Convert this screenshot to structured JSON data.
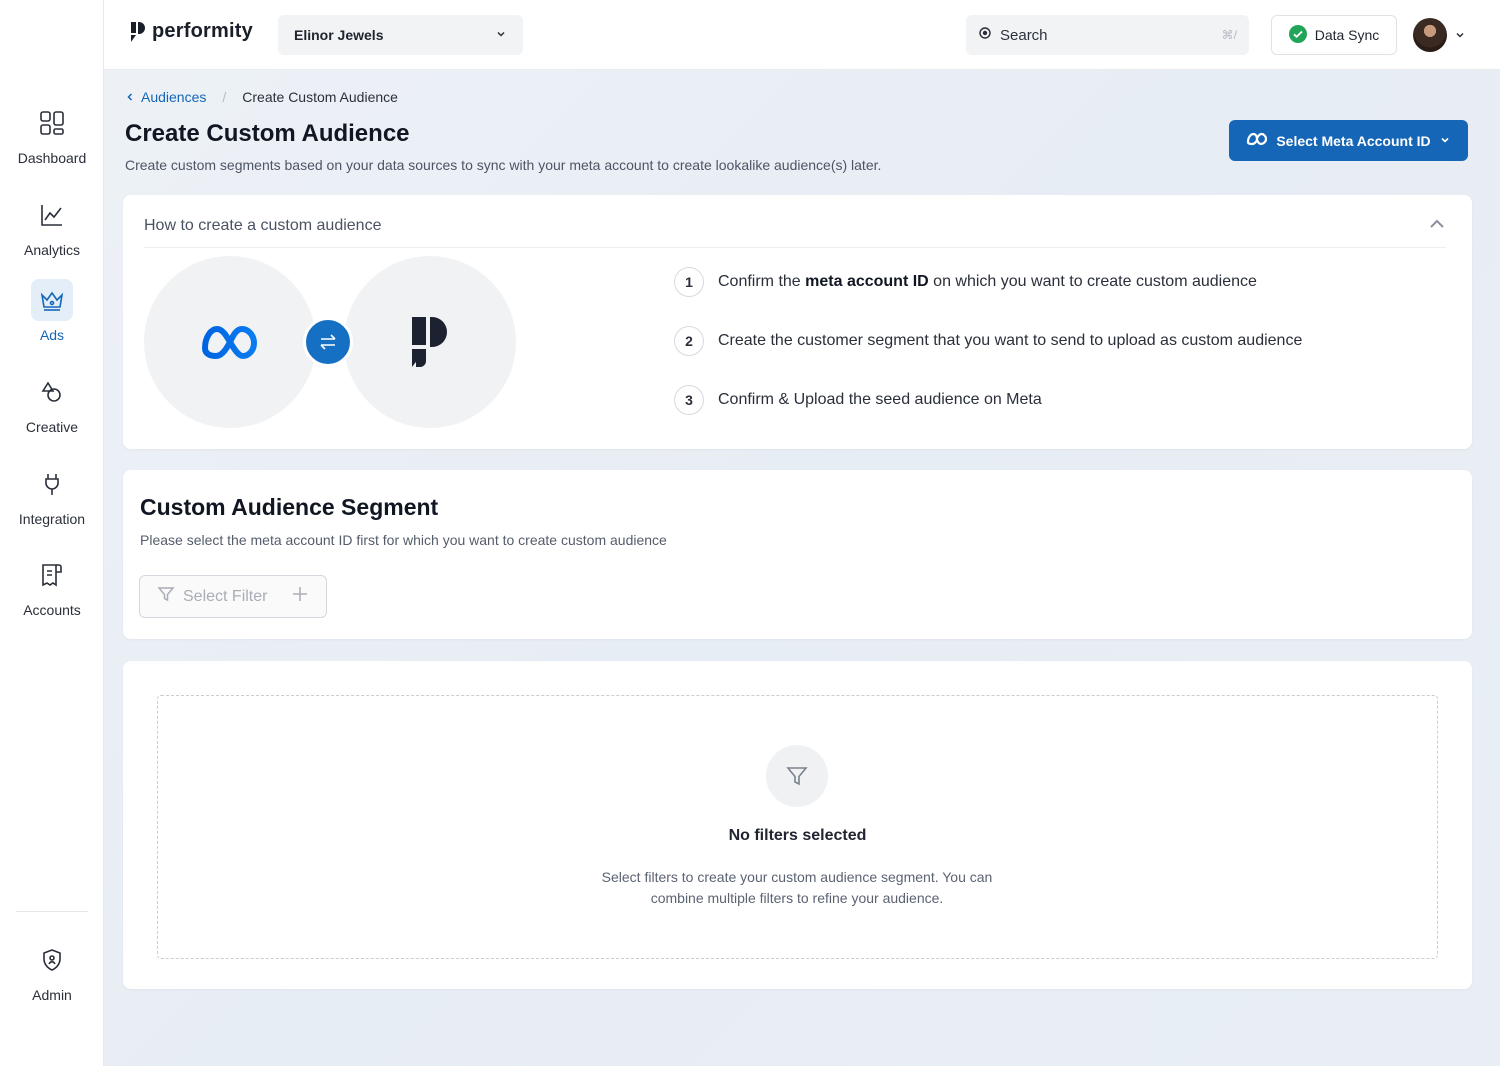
{
  "app": {
    "logo_text": "performity"
  },
  "header": {
    "store": "Elinor Jewels",
    "search_placeholder": "Search",
    "search_shortcut": "⌘/",
    "data_sync_label": "Data Sync"
  },
  "sidebar": {
    "items": [
      {
        "label": "Dashboard",
        "icon": "dashboard-icon"
      },
      {
        "label": "Analytics",
        "icon": "analytics-icon"
      },
      {
        "label": "Ads",
        "icon": "crown-icon",
        "active": true
      },
      {
        "label": "Creative",
        "icon": "creative-icon"
      },
      {
        "label": "Integration",
        "icon": "plug-icon"
      },
      {
        "label": "Accounts",
        "icon": "accounts-icon"
      }
    ],
    "admin_label": "Admin"
  },
  "breadcrumb": {
    "parent": "Audiences",
    "separator": "/",
    "current": "Create Custom Audience"
  },
  "page": {
    "title": "Create Custom Audience",
    "subtitle": "Create custom segments based on your data sources to sync with your meta account to create lookalike audience(s) later.",
    "meta_button": "Select Meta Account ID"
  },
  "how_to": {
    "title": "How to create a custom audience",
    "steps": [
      {
        "num": "1",
        "pre": "Confirm the ",
        "bold": "meta account ID",
        "post": " on which you want to create custom audience"
      },
      {
        "num": "2",
        "pre": "Create the customer segment that you want to send to upload as custom audience",
        "bold": "",
        "post": ""
      },
      {
        "num": "3",
        "pre": "Confirm & Upload the seed audience on Meta",
        "bold": "",
        "post": ""
      }
    ]
  },
  "segment": {
    "title": "Custom Audience Segment",
    "subtitle": "Please select the meta account ID first for which you want to create custom audience",
    "filter_button": "Select Filter"
  },
  "empty_state": {
    "title": "No filters selected",
    "text": "Select filters to create your custom audience segment. You can combine multiple filters to refine your audience."
  },
  "colors": {
    "primary": "#1566b7",
    "success": "#22a55a"
  }
}
